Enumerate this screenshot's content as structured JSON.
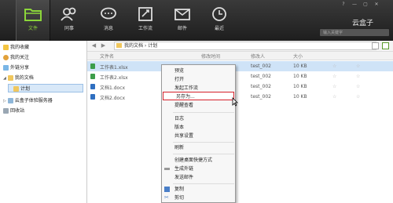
{
  "nav": [
    {
      "label": "文件",
      "icon": "folder-icon",
      "active": true
    },
    {
      "label": "同事",
      "icon": "colleagues-icon",
      "active": false
    },
    {
      "label": "消息",
      "icon": "message-icon",
      "active": false
    },
    {
      "label": "工作流",
      "icon": "workflow-icon",
      "active": false
    },
    {
      "label": "邮件",
      "icon": "mail-icon",
      "active": false
    },
    {
      "label": "最近",
      "icon": "clock-icon",
      "active": false
    }
  ],
  "brand": "云盒子",
  "window_controls": [
    "?",
    "—",
    "▢",
    "✕"
  ],
  "search": {
    "placeholder": "输入关键字"
  },
  "sidebar": {
    "items": [
      {
        "label": "我的收藏"
      },
      {
        "label": "我的关注"
      },
      {
        "label": "外链分享"
      },
      {
        "label": "我的文档"
      },
      {
        "label": "计划"
      },
      {
        "label": "云盒子体验服务器"
      },
      {
        "label": "回收站"
      }
    ]
  },
  "address": {
    "crumbs": "我的文档 › 计划"
  },
  "columns": {
    "name": "文件名",
    "modified": "修改时间",
    "modifier": "修改人",
    "size": "大小"
  },
  "files": [
    {
      "name": "工作表1.xlsx",
      "modifier": "test_002",
      "size": "10 KB"
    },
    {
      "name": "工作表2.xlsx",
      "modifier": "test_002",
      "size": "10 KB"
    },
    {
      "name": "文档1.docx",
      "modifier": "test_002",
      "size": "10 KB"
    },
    {
      "name": "文档2.docx",
      "modifier": "test_002",
      "size": "10 KB"
    }
  ],
  "context_menu": {
    "items": [
      "预览",
      "打开",
      "发起工作流",
      "另存为...",
      "提醒查看",
      "日志",
      "版本",
      "共享设置",
      "刷新",
      "创建桌面快捷方式",
      "生成外链",
      "发送邮件",
      "复制",
      "剪切"
    ]
  },
  "colors": {
    "accent_green": "#8cd63a",
    "highlight_red": "#d6212b",
    "selection_blue": "#cfe3f7"
  }
}
